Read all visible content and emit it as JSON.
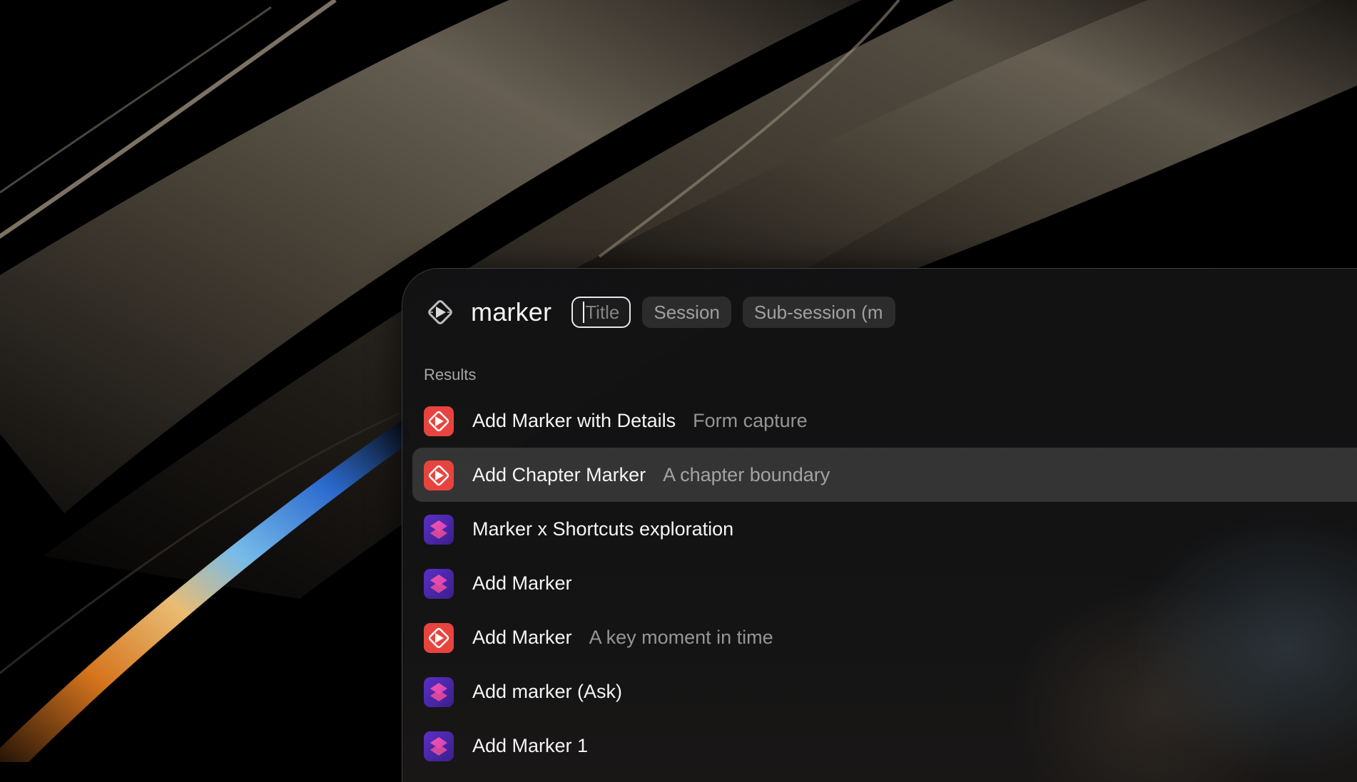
{
  "search": {
    "query": "marker",
    "tokens": [
      {
        "label": "Title",
        "active": true
      },
      {
        "label": "Session",
        "active": false
      },
      {
        "label": "Sub-session (m",
        "active": false
      }
    ]
  },
  "results": {
    "section_label": "Results",
    "items": [
      {
        "title": "Add Marker with Details",
        "subtitle": "Form capture",
        "icon": "marker-app-icon",
        "accessory": "drive-icon",
        "selected": false
      },
      {
        "title": "Add Chapter Marker",
        "subtitle": "A chapter boundary",
        "icon": "marker-app-icon",
        "accessory": "drive-icon",
        "selected": true
      },
      {
        "title": "Marker x Shortcuts exploration",
        "subtitle": "",
        "icon": "shortcuts-icon",
        "accessory": "",
        "selected": false
      },
      {
        "title": "Add Marker",
        "subtitle": "",
        "icon": "shortcuts-icon",
        "accessory": "",
        "selected": false
      },
      {
        "title": "Add Marker",
        "subtitle": "A key moment in time",
        "icon": "marker-app-icon",
        "accessory": "drive-icon",
        "selected": false
      },
      {
        "title": "Add marker (Ask)",
        "subtitle": "",
        "icon": "shortcuts-icon",
        "accessory": "",
        "selected": false
      },
      {
        "title": "Add Marker 1",
        "subtitle": "",
        "icon": "shortcuts-icon",
        "accessory": "",
        "selected": false
      }
    ]
  },
  "colors": {
    "marker_icon": "#e8443f",
    "shortcuts_icon_start": "#e0388f",
    "shortcuts_icon_end": "#6a3fd8",
    "selected_row": "#2a2a2b"
  }
}
